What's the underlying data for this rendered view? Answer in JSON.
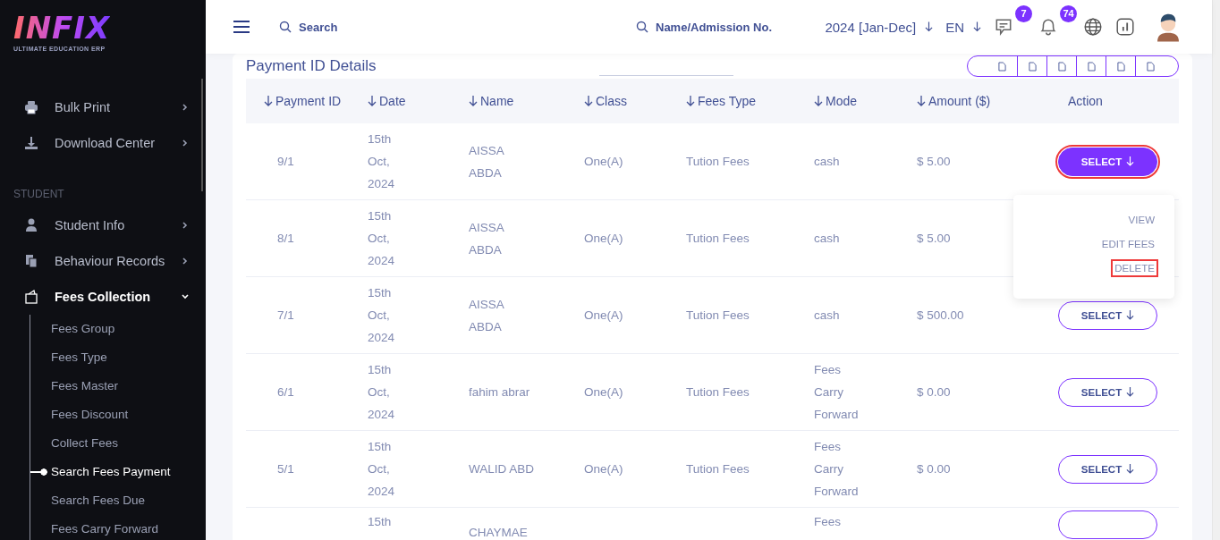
{
  "sidebar": {
    "logo": {
      "title": "INFIX",
      "subtitle": "ULTIMATE EDUCATION ERP"
    },
    "menu": [
      {
        "kind": "item",
        "label": "Bulk Print"
      },
      {
        "kind": "item",
        "label": "Download Center"
      },
      {
        "kind": "section",
        "label": "STUDENT"
      },
      {
        "kind": "item",
        "label": "Student Info"
      },
      {
        "kind": "item",
        "label": "Behaviour Records"
      },
      {
        "kind": "group",
        "label": "Fees Collection",
        "expanded": true,
        "children": [
          {
            "label": "Fees Group",
            "selected": false
          },
          {
            "label": "Fees Type",
            "selected": false
          },
          {
            "label": "Fees Master",
            "selected": false
          },
          {
            "label": "Fees Discount",
            "selected": false
          },
          {
            "label": "Collect Fees",
            "selected": false
          },
          {
            "label": "Search Fees Payment",
            "selected": true
          },
          {
            "label": "Search Fees Due",
            "selected": false
          },
          {
            "label": "Fees Carry Forward",
            "selected": false
          }
        ]
      }
    ]
  },
  "topbar": {
    "search": {
      "placeholder": "Search"
    },
    "student_search": {
      "placeholder": "Name/Admission No."
    },
    "session": "2024 [Jan-Dec]",
    "language": "EN",
    "messages_badge": "7",
    "notifications_badge": "74"
  },
  "card": {
    "title": "Payment ID Details",
    "columns": [
      {
        "label": "Payment ID",
        "sortable": true
      },
      {
        "label": "Date",
        "sortable": true
      },
      {
        "label": "Name",
        "sortable": true
      },
      {
        "label": "Class",
        "sortable": true
      },
      {
        "label": "Fees Type",
        "sortable": true
      },
      {
        "label": "Mode",
        "sortable": true
      },
      {
        "label": "Amount ($)",
        "sortable": true
      },
      {
        "label": "Action",
        "sortable": false
      }
    ],
    "rows": [
      {
        "payment_id": "9/1",
        "date": "15th Oct, 2024",
        "name": "AISSA ABDA",
        "class": "One(A)",
        "fees_type": "Tution Fees",
        "mode": "cash",
        "amount": "$ 5.00",
        "action": {
          "label": "SELECT",
          "selected": true,
          "highlighted": true
        }
      },
      {
        "payment_id": "8/1",
        "date": "15th Oct, 2024",
        "name": "AISSA ABDA",
        "class": "One(A)",
        "fees_type": "Tution Fees",
        "mode": "cash",
        "amount": "$ 5.00"
      },
      {
        "payment_id": "7/1",
        "date": "15th Oct, 2024",
        "name": "AISSA ABDA",
        "class": "One(A)",
        "fees_type": "Tution Fees",
        "mode": "cash",
        "amount": "$ 500.00",
        "action": {
          "label": "SELECT",
          "selected": false,
          "highlighted": false
        }
      },
      {
        "payment_id": "6/1",
        "date": "15th Oct, 2024",
        "name": "fahim abrar",
        "class": "One(A)",
        "fees_type": "Tution Fees",
        "mode": "Fees Carry Forward",
        "amount": "$ 0.00",
        "action": {
          "label": "SELECT",
          "selected": false,
          "highlighted": false
        }
      },
      {
        "payment_id": "5/1",
        "date": "15th Oct, 2024",
        "name": "WALID ABD",
        "class": "One(A)",
        "fees_type": "Tution Fees",
        "mode": "Fees Carry Forward",
        "amount": "$ 0.00",
        "action": {
          "label": "SELECT",
          "selected": false,
          "highlighted": false
        }
      },
      {
        "date": "15th",
        "name": "CHAYMAE",
        "mode": "Fees",
        "action": {
          "selected": false,
          "highlighted": false
        }
      }
    ],
    "action_menu": {
      "items": [
        {
          "label": "VIEW",
          "highlighted": false
        },
        {
          "label": "EDIT FEES",
          "highlighted": false
        },
        {
          "label": "DELETE",
          "highlighted": true
        }
      ]
    }
  }
}
